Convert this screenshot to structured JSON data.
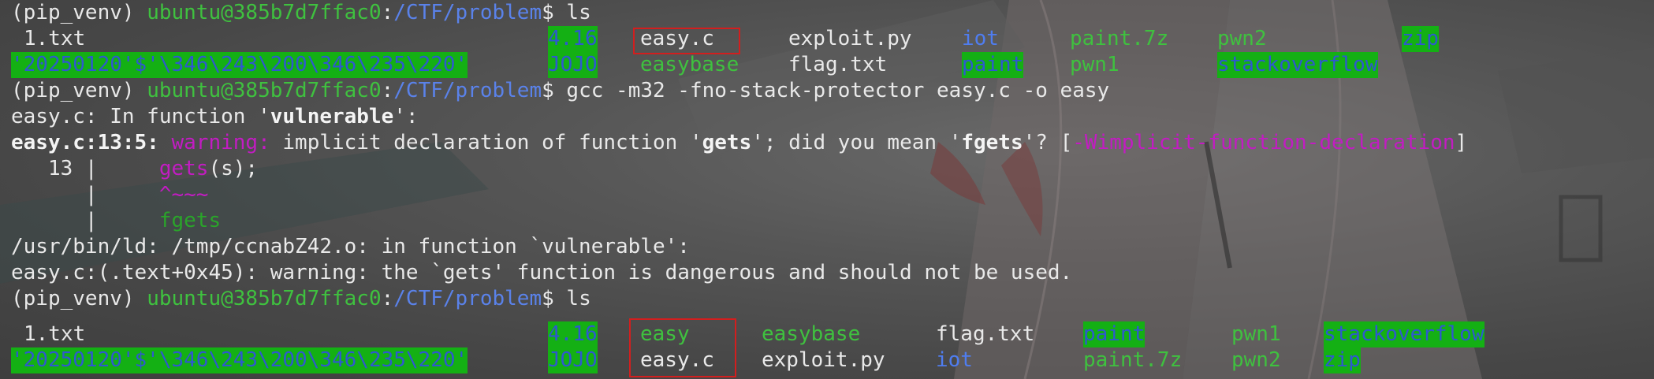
{
  "terminal": {
    "env": "(pip_venv) ",
    "user_host": "ubuntu@385b7d7ffac0",
    "colon": ":",
    "path": "/CTF/problem",
    "prompt_end": "$ ",
    "cmd_ls": "ls",
    "cmd_gcc": "gcc -m32 -fno-stack-protector easy.c -o easy"
  },
  "ls1": {
    "row1": {
      "txt": "1.txt",
      "d416": "4.16",
      "easyc": "easy.c",
      "exploit": "exploit.py",
      "iot": "iot",
      "paint7z": "paint.7z",
      "pwn2": "pwn2",
      "zip": "zip"
    },
    "row2": {
      "weird": "'20250120'$'\\346\\243\\200\\346\\235\\220'",
      "jojo": "JOJO",
      "easybase": "easybase",
      "flag": "flag.txt",
      "paint": "paint",
      "pwn1": "pwn1",
      "stackoverflow": "stackoverflow"
    }
  },
  "gcc_output": {
    "l1a": "easy.c: In function '",
    "l1b": "vulnerable",
    "l1c": "':",
    "l2a": "easy.c:13:5: ",
    "l2warn": "warning: ",
    "l2b": "implicit declaration of function '",
    "l2c": "gets",
    "l2d": "'; did you mean '",
    "l2e": "fgets",
    "l2f": "'? [",
    "l2flag": "-Wimplicit-function-declaration",
    "l2g": "]",
    "l3a": "   13 |     ",
    "l3b": "gets",
    "l3c": "(s);",
    "l4a": "      |     ",
    "l4b": "^~~~",
    "l5a": "      |     ",
    "l5b": "fgets",
    "l6": "/usr/bin/ld: /tmp/ccnabZ42.o: in function `vulnerable':",
    "l7": "easy.c:(.text+0x45): warning: the `gets' function is dangerous and should not be used."
  },
  "ls2": {
    "row1": {
      "txt": "1.txt",
      "d416": "4.16",
      "easy": "easy",
      "easybase": "easybase",
      "flag": "flag.txt",
      "paint": "paint",
      "pwn1": "pwn1",
      "stackoverflow": "stackoverflow"
    },
    "row2": {
      "weird": "'20250120'$'\\346\\243\\200\\346\\235\\220'",
      "jojo": "JOJO",
      "easyc": "easy.c",
      "exploit": "exploit.py",
      "iot": "iot",
      "paint7z": "paint.7z",
      "pwn2": "pwn2",
      "zip": "zip"
    }
  },
  "colors": {
    "prompt_user": "#3fc13f",
    "prompt_path": "#5a82ea",
    "highlight_bg": "#14b014",
    "warning": "#c21cc2",
    "annotation_box": "#d31e1e"
  }
}
